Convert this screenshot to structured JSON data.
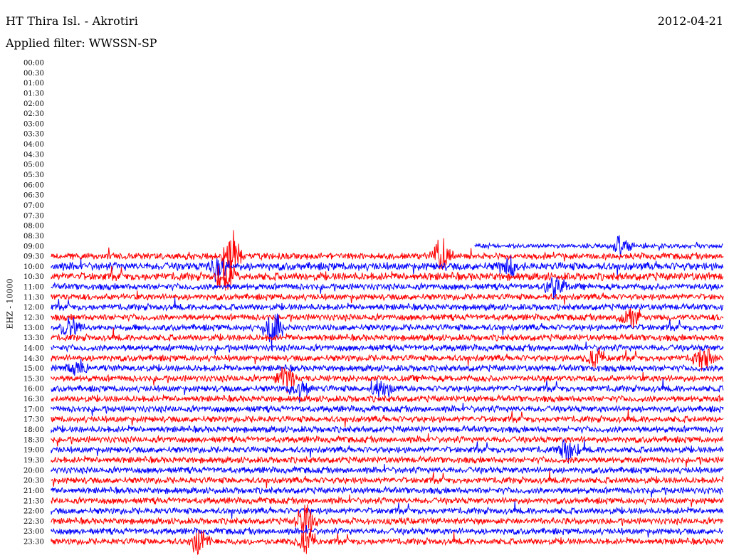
{
  "header": {
    "station": "HT Thira Isl. - Akrotiri",
    "date": "2012-04-21",
    "filter": "Applied filter: WWSSN-SP"
  },
  "chart_data": {
    "type": "line",
    "title": "HT Thira Isl. - Akrotiri",
    "date": "2012-04-21",
    "filter": "WWSSN-SP",
    "ylabel": "EHZ - 10000",
    "row_labels": [
      "00:00",
      "00:30",
      "01:00",
      "01:30",
      "02:00",
      "02:30",
      "03:00",
      "03:30",
      "04:00",
      "04:30",
      "05:00",
      "05:30",
      "06:00",
      "06:30",
      "07:00",
      "07:30",
      "08:00",
      "08:30",
      "09:00",
      "09:30",
      "10:00",
      "10:30",
      "11:00",
      "11:30",
      "12:00",
      "12:30",
      "13:00",
      "13:30",
      "14:00",
      "14:30",
      "15:00",
      "15:30",
      "16:00",
      "16:30",
      "17:00",
      "17:30",
      "18:00",
      "18:30",
      "19:00",
      "19:30",
      "20:00",
      "20:30",
      "21:00",
      "21:30",
      "22:00",
      "22:30",
      "23:00",
      "23:30"
    ],
    "data_start": "09:00",
    "data_start_fraction_of_row": 0.63,
    "row_colors": [
      "#0000ff",
      "#ff0000"
    ],
    "row_noise_amplitude": [
      0,
      0,
      0,
      0,
      0,
      0,
      0,
      0,
      0,
      0,
      0,
      0,
      0,
      0,
      0,
      0,
      0,
      0,
      3,
      4,
      5,
      5,
      4,
      4,
      4,
      4,
      4,
      4,
      4,
      4,
      4,
      4,
      4,
      4,
      4,
      4,
      4,
      4,
      4,
      4,
      4,
      4,
      4,
      4,
      4,
      4,
      4,
      4
    ],
    "events": [
      {
        "row": "09:00",
        "x": 0.85,
        "amp": 18
      },
      {
        "row": "09:30",
        "x": 0.27,
        "amp": 28
      },
      {
        "row": "09:30",
        "x": 0.58,
        "amp": 22
      },
      {
        "row": "10:00",
        "x": 0.25,
        "amp": 20
      },
      {
        "row": "10:00",
        "x": 0.68,
        "amp": 14
      },
      {
        "row": "10:30",
        "x": 0.26,
        "amp": 22
      },
      {
        "row": "11:00",
        "x": 0.75,
        "amp": 14
      },
      {
        "row": "12:30",
        "x": 0.86,
        "amp": 16
      },
      {
        "row": "13:00",
        "x": 0.03,
        "amp": 14
      },
      {
        "row": "13:00",
        "x": 0.33,
        "amp": 26
      },
      {
        "row": "14:30",
        "x": 0.81,
        "amp": 14
      },
      {
        "row": "14:30",
        "x": 0.97,
        "amp": 14
      },
      {
        "row": "15:00",
        "x": 0.04,
        "amp": 12
      },
      {
        "row": "15:30",
        "x": 0.35,
        "amp": 18
      },
      {
        "row": "16:00",
        "x": 0.49,
        "amp": 18
      },
      {
        "row": "16:00",
        "x": 0.37,
        "amp": 14
      },
      {
        "row": "19:00",
        "x": 0.77,
        "amp": 14
      },
      {
        "row": "22:30",
        "x": 0.38,
        "amp": 22
      },
      {
        "row": "23:30",
        "x": 0.22,
        "amp": 16
      },
      {
        "row": "23:30",
        "x": 0.38,
        "amp": 18
      }
    ],
    "grid": false,
    "legend": "none"
  }
}
